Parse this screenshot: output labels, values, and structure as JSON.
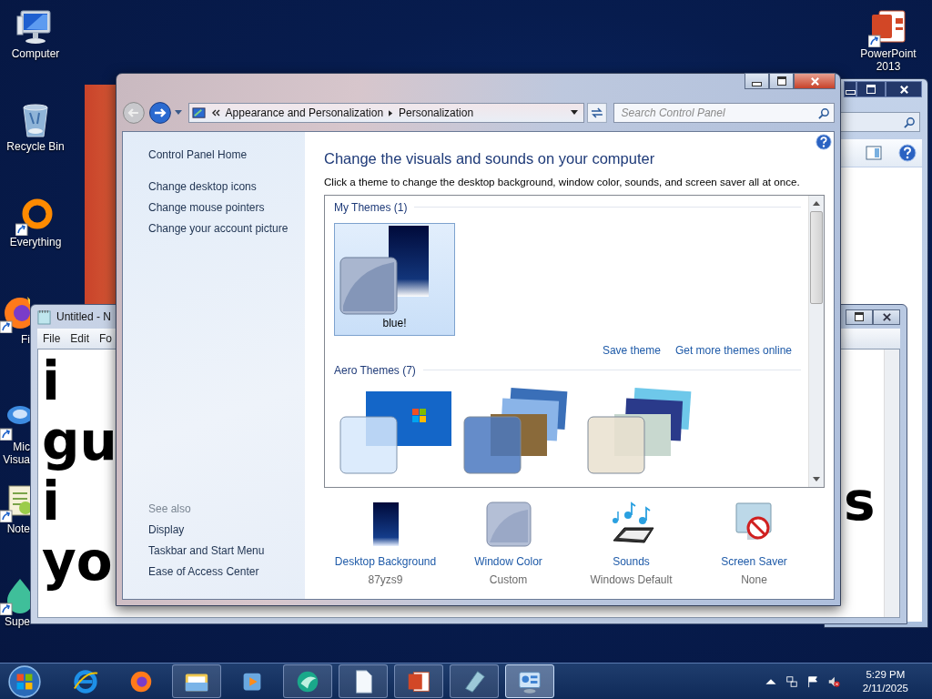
{
  "desktop": {
    "icons": [
      {
        "lines": [
          "Computer"
        ],
        "kind": "computer",
        "shortcut": false
      },
      {
        "lines": [
          "Recycle Bin"
        ],
        "kind": "recycle-bin",
        "shortcut": false
      },
      {
        "lines": [
          "Everything"
        ],
        "kind": "ring",
        "shortcut": true
      }
    ],
    "covered_icons": [
      {
        "lines": [
          "Fi"
        ],
        "kind": "fox",
        "shortcut": true
      },
      {
        "lines": [
          "Mic",
          "Visua"
        ],
        "kind": "blob",
        "shortcut": true
      },
      {
        "lines": [
          "Note"
        ],
        "kind": "notepad",
        "shortcut": true
      },
      {
        "lines": [
          "Supe"
        ],
        "kind": "drop",
        "shortcut": true
      }
    ],
    "right_icons": [
      {
        "lines": [
          "PowerPoint",
          "2013"
        ],
        "kind": "slides",
        "shortcut": true
      }
    ]
  },
  "notepad": {
    "title": "Untitled - N",
    "menu": [
      "File",
      "Edit",
      "Fo"
    ],
    "text_lines": [
      "i",
      "gu",
      "i",
      "yo"
    ],
    "text_right": "s"
  },
  "control_panel": {
    "breadcrumb": [
      "Appearance and Personalization",
      "Personalization"
    ],
    "search": {
      "placeholder": "Search Control Panel"
    },
    "sidebar": {
      "home": "Control Panel Home",
      "links": [
        "Change desktop icons",
        "Change mouse pointers",
        "Change your account picture"
      ],
      "see_also_heading": "See also",
      "see_also": [
        "Display",
        "Taskbar and Start Menu",
        "Ease of Access Center"
      ]
    },
    "heading": "Change the visuals and sounds on your computer",
    "description": "Click a theme to change the desktop background, window color, sounds, and screen saver all at once.",
    "theme_groups": [
      {
        "heading": "My Themes (1)",
        "themes": [
          {
            "name": "blue!",
            "kind": "custom",
            "selected": true
          }
        ],
        "links": [
          "Save theme",
          "Get more themes online"
        ]
      },
      {
        "heading": "Aero Themes (7)",
        "themes": [
          {
            "kind": "single",
            "selected": false
          },
          {
            "kind": "stack-blue",
            "selected": false
          },
          {
            "kind": "stack-beige",
            "selected": false
          }
        ]
      }
    ],
    "settings": [
      {
        "label": "Desktop Background",
        "value": "87yzs9",
        "kind": "background"
      },
      {
        "label": "Window Color",
        "value": "Custom",
        "kind": "color"
      },
      {
        "label": "Sounds",
        "value": "Windows Default",
        "kind": "sounds"
      },
      {
        "label": "Screen Saver",
        "value": "None",
        "kind": "screen-saver"
      }
    ]
  },
  "taskbar": {
    "items": [
      {
        "kind": "browser-e",
        "running": false,
        "selected": false
      },
      {
        "kind": "fox",
        "running": false,
        "selected": false
      },
      {
        "kind": "folder",
        "running": true,
        "selected": false
      },
      {
        "kind": "media",
        "running": false,
        "selected": false
      },
      {
        "kind": "swirl",
        "running": true,
        "selected": false
      },
      {
        "kind": "page",
        "running": true,
        "selected": false
      },
      {
        "kind": "slides",
        "running": true,
        "selected": false
      },
      {
        "kind": "pen",
        "running": true,
        "selected": false
      },
      {
        "kind": "control-panel",
        "running": true,
        "selected": true
      }
    ],
    "clock": {
      "time": "5:29 PM",
      "date": "2/11/2025"
    }
  }
}
